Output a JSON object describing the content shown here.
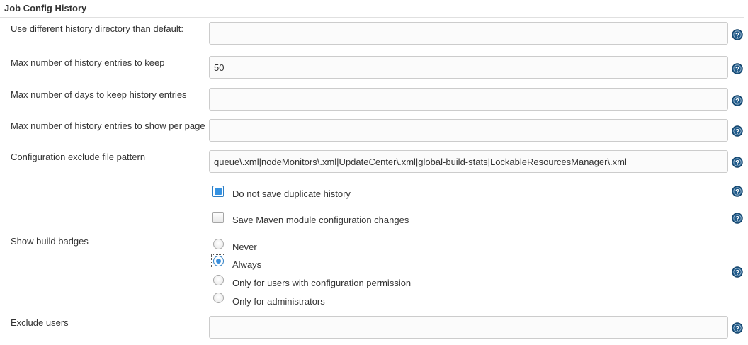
{
  "section": {
    "title": "Job Config History"
  },
  "fields": {
    "history_dir": {
      "label": "Use different history directory than default:",
      "value": ""
    },
    "max_entries": {
      "label": "Max number of history entries to keep",
      "value": "50"
    },
    "max_days": {
      "label": "Max number of days to keep history entries",
      "value": ""
    },
    "max_per_page": {
      "label": "Max number of history entries to show per page",
      "value": ""
    },
    "exclude_pattern": {
      "label": "Configuration exclude file pattern",
      "value": "queue\\.xml|nodeMonitors\\.xml|UpdateCenter\\.xml|global-build-stats|LockableResourcesManager\\.xml"
    },
    "exclude_users": {
      "label": "Exclude users",
      "value": ""
    }
  },
  "checkboxes": {
    "no_duplicates": {
      "label": "Do not save duplicate history",
      "checked": true
    },
    "maven_module": {
      "label": "Save Maven module configuration changes",
      "checked": false
    }
  },
  "badges": {
    "label": "Show build badges",
    "options": [
      {
        "label": "Never",
        "checked": false
      },
      {
        "label": "Always",
        "checked": true
      },
      {
        "label": "Only for users with configuration permission",
        "checked": false
      },
      {
        "label": "Only for administrators",
        "checked": false
      }
    ]
  },
  "colors": {
    "help_icon": "#1f5a8a",
    "accent": "#3592e2"
  },
  "icons": {
    "help": "question-help-icon"
  }
}
